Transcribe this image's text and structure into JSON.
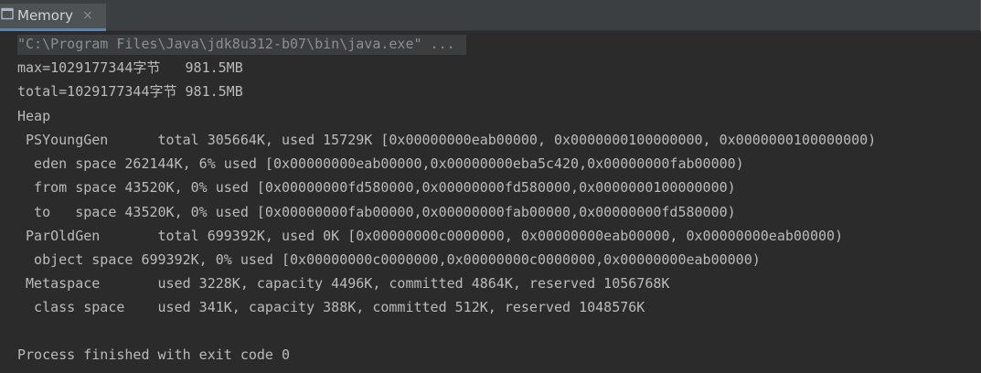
{
  "tab": {
    "label": "Memory",
    "close_glyph": "×",
    "icon": "console-icon"
  },
  "console": {
    "command_line": "\"C:\\Program Files\\Java\\jdk8u312-b07\\bin\\java.exe\" ...",
    "lines": [
      "max=1029177344字节   981.5MB",
      "total=1029177344字节 981.5MB",
      "Heap",
      " PSYoungGen      total 305664K, used 15729K [0x00000000eab00000, 0x0000000100000000, 0x0000000100000000)",
      "  eden space 262144K, 6% used [0x00000000eab00000,0x00000000eba5c420,0x00000000fab00000)",
      "  from space 43520K, 0% used [0x00000000fd580000,0x00000000fd580000,0x0000000100000000)",
      "  to   space 43520K, 0% used [0x00000000fab00000,0x00000000fab00000,0x00000000fd580000)",
      " ParOldGen       total 699392K, used 0K [0x00000000c0000000, 0x00000000eab00000, 0x00000000eab00000)",
      "  object space 699392K, 0% used [0x00000000c0000000,0x00000000c0000000,0x00000000eab00000)",
      " Metaspace       used 3228K, capacity 4496K, committed 4864K, reserved 1056768K",
      "  class space    used 341K, capacity 388K, committed 512K, reserved 1048576K",
      "",
      "Process finished with exit code 0"
    ]
  },
  "colors": {
    "background": "#2b2b2b",
    "tabbar": "#3c3f41",
    "tab_active": "#4e5254",
    "tab_accent": "#4a88c7",
    "text": "#bbbbbb",
    "command_text": "#8a8f93"
  }
}
